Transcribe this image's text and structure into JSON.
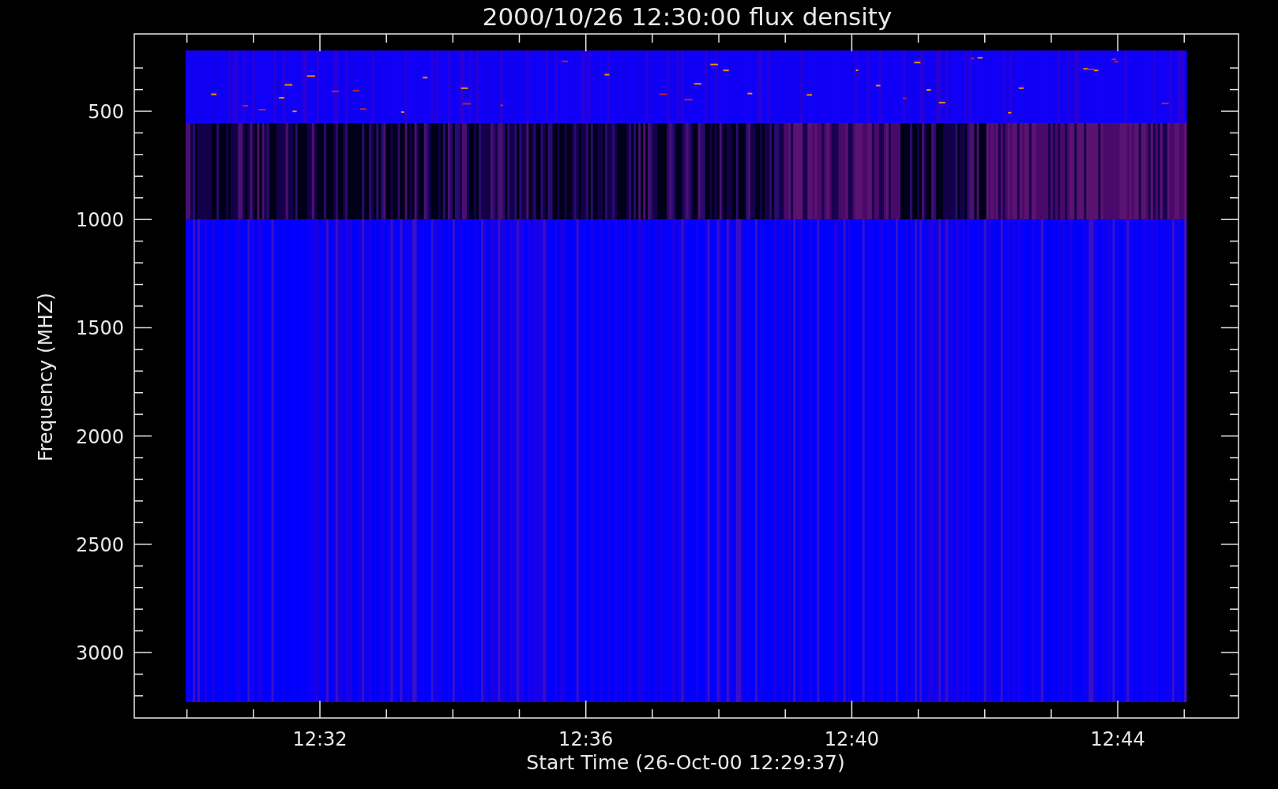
{
  "title": "2000/10/26 12:30:00 flux density",
  "y_axis": {
    "label": "Frequency (MHZ)",
    "ticks": [
      "500",
      "1000",
      "1500",
      "2000",
      "2500",
      "3000"
    ]
  },
  "x_axis": {
    "label": "Start Time (26-Oct-00 12:29:37)",
    "ticks": [
      "12:32",
      "12:36",
      "12:40",
      "12:44"
    ]
  }
}
